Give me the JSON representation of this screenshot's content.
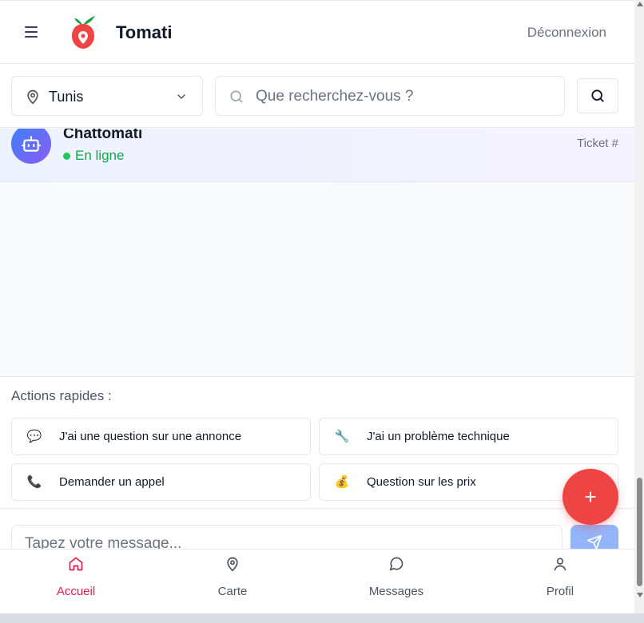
{
  "header": {
    "brand": "Tomati",
    "logout_label": "Déconnexion"
  },
  "search": {
    "city": "Tunis",
    "placeholder": "Que recherchez-vous ?"
  },
  "chat": {
    "bot_name": "Chattomati",
    "status": "En ligne",
    "ticket": "Ticket #"
  },
  "quick_actions": {
    "title": "Actions rapides :",
    "items": [
      {
        "icon": "speech-bubble-icon",
        "emoji": "💬",
        "label": "J'ai une question sur une annonce"
      },
      {
        "icon": "wrench-icon",
        "emoji": "🔧",
        "label": "J'ai un problème technique"
      },
      {
        "icon": "phone-icon",
        "emoji": "📞",
        "label": "Demander un appel"
      },
      {
        "icon": "money-bag-icon",
        "emoji": "💰",
        "label": "Question sur les prix"
      }
    ]
  },
  "compose": {
    "placeholder": "Tapez votre message..."
  },
  "fab": {
    "label": "+"
  },
  "nav": {
    "items": [
      {
        "label": "Accueil",
        "icon": "home-icon",
        "active": true
      },
      {
        "label": "Carte",
        "icon": "map-pin-icon",
        "active": false
      },
      {
        "label": "Messages",
        "icon": "chat-bubble-icon",
        "active": false
      },
      {
        "label": "Profil",
        "icon": "user-icon",
        "active": false
      }
    ]
  },
  "colors": {
    "accent": "#e11d48",
    "fab": "#ef4444",
    "online": "#16a34a",
    "send_button": "#93b4f8"
  }
}
